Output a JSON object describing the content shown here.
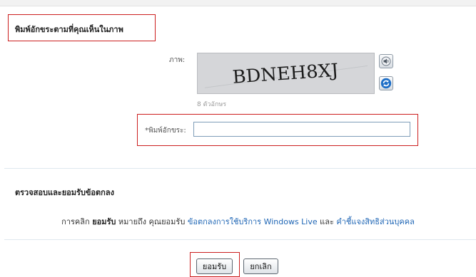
{
  "captcha_section": {
    "heading": "พิมพ์อักขระตามที่คุณเห็นในภาพ",
    "image_label": "ภาพ:",
    "captcha_text": "BDNEH8XJ",
    "char_count": "8 ตัวอักษร",
    "input_label": "*พิมพ์อักขระ:",
    "input_value": ""
  },
  "terms_section": {
    "heading": "ตรวจสอบและยอมรับข้อตกลง",
    "line_prefix": "การคลิก",
    "line_bold": "ยอมรับ",
    "line_middle": "หมายถึง คุณยอมรับ",
    "link_terms": "ข้อตกลงการใช้บริการ Windows Live",
    "line_and": "และ",
    "link_privacy": "คำชี้แจงสิทธิส่วนบุคคล"
  },
  "actions": {
    "accept_label": "ยอมรับ",
    "cancel_label": "ยกเลิก"
  },
  "icons": {
    "audio": "speaker-icon",
    "refresh": "refresh-icon"
  },
  "colors": {
    "highlight": "#cc1f1f",
    "link": "#1f66b5",
    "captcha_bg": "#d5d6d9"
  }
}
